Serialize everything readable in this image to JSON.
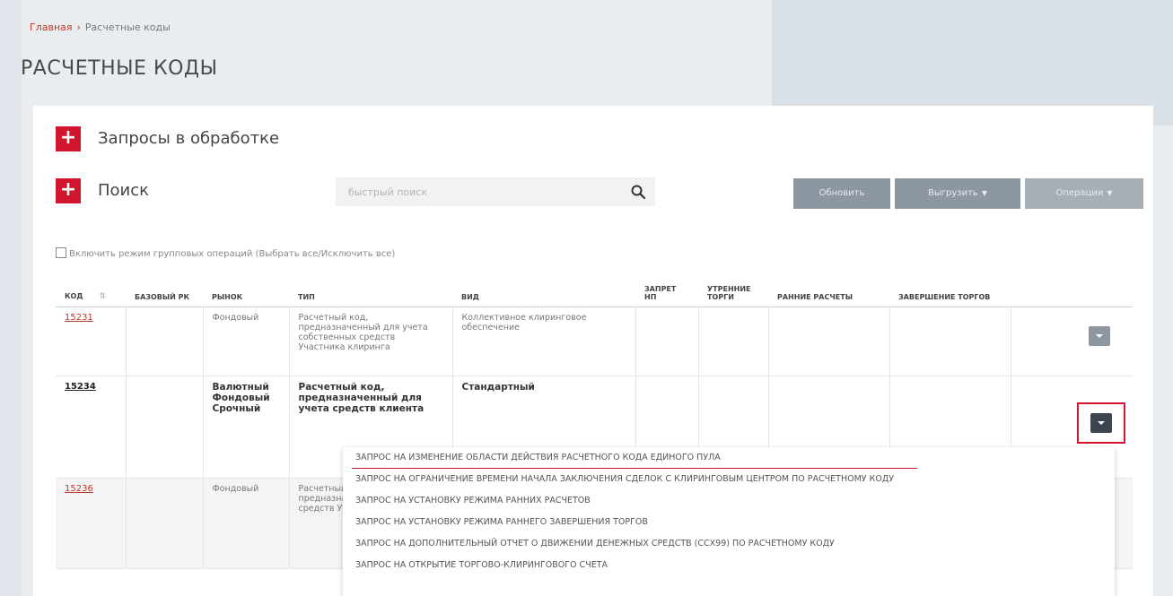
{
  "breadcrumb": {
    "home": "Главная",
    "current": "Расчетные коды"
  },
  "page": {
    "title": "РАСЧЕТНЫЕ КОДЫ"
  },
  "sections": {
    "requests": "Запросы в обработке",
    "search": "Поиск"
  },
  "search": {
    "placeholder": "быстрый поиск"
  },
  "toolbar": {
    "refresh": "Обновить",
    "export": "Выгрузить",
    "operations": "Операции"
  },
  "group_ops": {
    "label": "Включить режим групповых операций (Выбрать все/Исключить все)"
  },
  "table": {
    "headers": {
      "code": "КОД",
      "base_rk": "БАЗОВЫЙ РК",
      "market": "РЫНОК",
      "type": "ТИП",
      "kind": "ВИД",
      "ban_np": "ЗАПРЕТ НП",
      "morning": "УТРЕННИЕ ТОРГИ",
      "early_settlement": "РАННИЕ РАСЧЕТЫ",
      "end_trading": "ЗАВЕРШЕНИЕ ТОРГОВ"
    },
    "rows": [
      {
        "code": "15231",
        "market": "Фондовый",
        "type": "Расчетный код, предназначенный для учета собственных средств Участника клиринга",
        "kind": "Коллективное клиринговое обеспечение"
      },
      {
        "code": "15234",
        "market": "Валютный Фондовый Срочный",
        "type": "Расчетный код, предназначенный для учета средств клиента",
        "kind": "Стандартный"
      },
      {
        "code": "15236",
        "market": "Фондовый",
        "type": "Расчетный код, предназначенный для учета средств Участника клиринга",
        "kind": ""
      }
    ]
  },
  "row_menu": {
    "items": [
      "ЗАПРОС НА ИЗМЕНЕНИЕ ОБЛАСТИ ДЕЙСТВИЯ РАСЧЕТНОГО КОДА ЕДИНОГО ПУЛА",
      "ЗАПРОС НА ОГРАНИЧЕНИЕ ВРЕМЕНИ НАЧАЛА ЗАКЛЮЧЕНИЯ СДЕЛОК С КЛИРИНГОВЫМ ЦЕНТРОМ ПО РАСЧЕТНОМУ КОДУ",
      "ЗАПРОС НА УСТАНОВКУ РЕЖИМА РАННИХ РАСЧЕТОВ",
      "ЗАПРОС НА УСТАНОВКУ РЕЖИМА РАННЕГО ЗАВЕРШЕНИЯ ТОРГОВ",
      "ЗАПРОС НА ДОПОЛНИТЕЛЬНЫЙ ОТЧЕТ О ДВИЖЕНИИ ДЕНЕЖНЫХ СРЕДСТВ (CCX99) ПО РАСЧЕТНОМУ КОДУ",
      "ЗАПРОС НА ОТКРЫТИЕ ТОРГОВО-КЛИРИНГОВОГО СЧЕТА"
    ]
  },
  "colors": {
    "accent": "#d0152c",
    "button": "#8c97a2",
    "button_dark": "#3d4650"
  }
}
